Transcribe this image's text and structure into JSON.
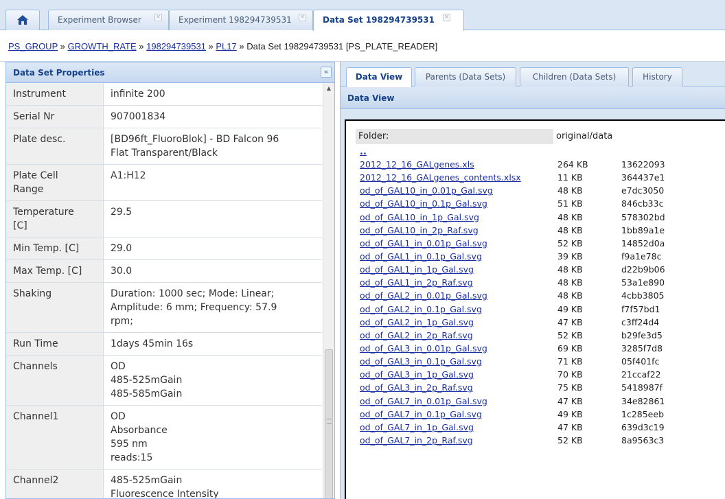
{
  "tabs": [
    {
      "label": "Experiment Browser",
      "close": "×"
    },
    {
      "label": "Experiment 198294739531",
      "close": "×"
    },
    {
      "label": "Data Set 198294739531",
      "close": "×"
    }
  ],
  "breadcrumb": {
    "items": [
      "PS_GROUP",
      "GROWTH_RATE",
      "198294739531",
      "PL17"
    ],
    "separator": "»",
    "current": "Data Set 198294739531 [PS_PLATE_READER]"
  },
  "left_panel": {
    "title": "Data Set Properties",
    "collapse": "«",
    "properties": [
      {
        "key": "Instrument",
        "value": "infinite 200"
      },
      {
        "key": "Serial Nr",
        "value": "907001834"
      },
      {
        "key": "Plate desc.",
        "value": "[BD96ft_FluoroBlok] - BD Falcon 96\nFlat Transparent/Black"
      },
      {
        "key": "Plate Cell\nRange",
        "value": "A1:H12"
      },
      {
        "key": "Temperature\n[C]",
        "value": "29.5"
      },
      {
        "key": "Min Temp. [C]",
        "value": "29.0"
      },
      {
        "key": "Max Temp. [C]",
        "value": "30.0"
      },
      {
        "key": "Shaking",
        "value": "Duration: 1000 sec; Mode: Linear;\nAmplitude: 6 mm; Frequency: 57.9\nrpm;"
      },
      {
        "key": "Run Time",
        "value": "1days 45min 16s"
      },
      {
        "key": "Channels",
        "value": "OD\n485-525mGain\n485-585mGain"
      },
      {
        "key": "Channel1",
        "value": "OD\nAbsorbance\n595 nm\nreads:15"
      },
      {
        "key": "Channel2",
        "value": "485-525mGain\nFluorescence Intensity"
      }
    ]
  },
  "right_panel": {
    "subtabs": [
      "Data View",
      "Parents (Data Sets)",
      "Children (Data Sets)",
      "History"
    ],
    "header": "Data View",
    "folder_label": "Folder:",
    "folder_value": "original/data",
    "parent_link": "..",
    "files": [
      {
        "name": "2012_12_16_GALgenes.xls",
        "size": "264 KB",
        "hash": "13622093"
      },
      {
        "name": "2012_12_16_GALgenes_contents.xlsx",
        "size": "11 KB",
        "hash": "364437e1"
      },
      {
        "name": "od_of_GAL10_in_0.01p_Gal.svg",
        "size": "48 KB",
        "hash": "e7dc3050"
      },
      {
        "name": "od_of_GAL10_in_0.1p_Gal.svg",
        "size": "51 KB",
        "hash": "846cb33c"
      },
      {
        "name": "od_of_GAL10_in_1p_Gal.svg",
        "size": "48 KB",
        "hash": "578302bd"
      },
      {
        "name": "od_of_GAL10_in_2p_Raf.svg",
        "size": "48 KB",
        "hash": "1bb89a1e"
      },
      {
        "name": "od_of_GAL1_in_0.01p_Gal.svg",
        "size": "52 KB",
        "hash": "14852d0a"
      },
      {
        "name": "od_of_GAL1_in_0.1p_Gal.svg",
        "size": "39 KB",
        "hash": "f9a1e78c"
      },
      {
        "name": "od_of_GAL1_in_1p_Gal.svg",
        "size": "48 KB",
        "hash": "d22b9b06"
      },
      {
        "name": "od_of_GAL1_in_2p_Raf.svg",
        "size": "48 KB",
        "hash": "53a1e890"
      },
      {
        "name": "od_of_GAL2_in_0.01p_Gal.svg",
        "size": "48 KB",
        "hash": "4cbb3805"
      },
      {
        "name": "od_of_GAL2_in_0.1p_Gal.svg",
        "size": "49 KB",
        "hash": "f7f57bd1"
      },
      {
        "name": "od_of_GAL2_in_1p_Gal.svg",
        "size": "47 KB",
        "hash": "c3ff24d4"
      },
      {
        "name": "od_of_GAL2_in_2p_Raf.svg",
        "size": "52 KB",
        "hash": "b29fe3d5"
      },
      {
        "name": "od_of_GAL3_in_0.01p_Gal.svg",
        "size": "69 KB",
        "hash": "3285f7d8"
      },
      {
        "name": "od_of_GAL3_in_0.1p_Gal.svg",
        "size": "71 KB",
        "hash": "05f401fc"
      },
      {
        "name": "od_of_GAL3_in_1p_Gal.svg",
        "size": "70 KB",
        "hash": "21ccaf22"
      },
      {
        "name": "od_of_GAL3_in_2p_Raf.svg",
        "size": "75 KB",
        "hash": "5418987f"
      },
      {
        "name": "od_of_GAL7_in_0.01p_Gal.svg",
        "size": "47 KB",
        "hash": "34e82861"
      },
      {
        "name": "od_of_GAL7_in_0.1p_Gal.svg",
        "size": "49 KB",
        "hash": "1c285eeb"
      },
      {
        "name": "od_of_GAL7_in_1p_Gal.svg",
        "size": "47 KB",
        "hash": "639d3c19"
      },
      {
        "name": "od_of_GAL7_in_2p_Raf.svg",
        "size": "52 KB",
        "hash": "8a9563c3"
      }
    ]
  },
  "colors": {
    "accent": "#15428b",
    "link": "#1a2fa3",
    "panel_border": "#99bbe8",
    "tab_bg": "#dbe6f5"
  },
  "icons": {
    "home": "home-icon",
    "close": "close-icon",
    "collapse": "double-chevron-left-icon"
  }
}
